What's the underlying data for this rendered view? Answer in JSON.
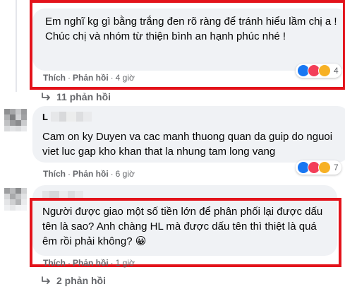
{
  "comments": [
    {
      "text": "Em nghĩ kg gì bằng trắng đen rõ ràng để tránh hiểu lầm chị a ! Chúc chị và nhóm từ thiện bình an hạnh phúc nhé !",
      "like": "Thích",
      "reply": "Phản hồi",
      "time": "4 giờ",
      "reaction_count": "4",
      "replies_label": "11 phản hồi"
    },
    {
      "author_initial": "L",
      "text": "Cam on ky Duyen va cac manh thuong quan da guip do nguoi viet luc gap kho khan that la nhung tam long vang",
      "like": "Thích",
      "reply": "Phản hồi",
      "time": "6 giờ",
      "reaction_count": "7"
    },
    {
      "text": "Người được giao một số tiền lớn để phân phối lại được dấu tên là sao? Anh chàng HL mà được dấu tên thì thiệt là quá êm rồi phải không? 😀",
      "like": "Thích",
      "reply": "Phản hồi",
      "time": "1 giờ",
      "replies_label": "2 phản hồi"
    }
  ],
  "icons": {
    "like": "like-reaction-icon",
    "love": "love-reaction-icon",
    "care": "care-reaction-icon",
    "haha": "haha-reaction-icon",
    "reply_arrow": "reply-arrow-icon"
  },
  "colors": {
    "highlight": "#e3131b",
    "bubble": "#f0f2f5",
    "meta": "#65676b",
    "like_blue": "#1877f2",
    "love_red": "#f33e58",
    "care_yellow": "#f7b125"
  }
}
